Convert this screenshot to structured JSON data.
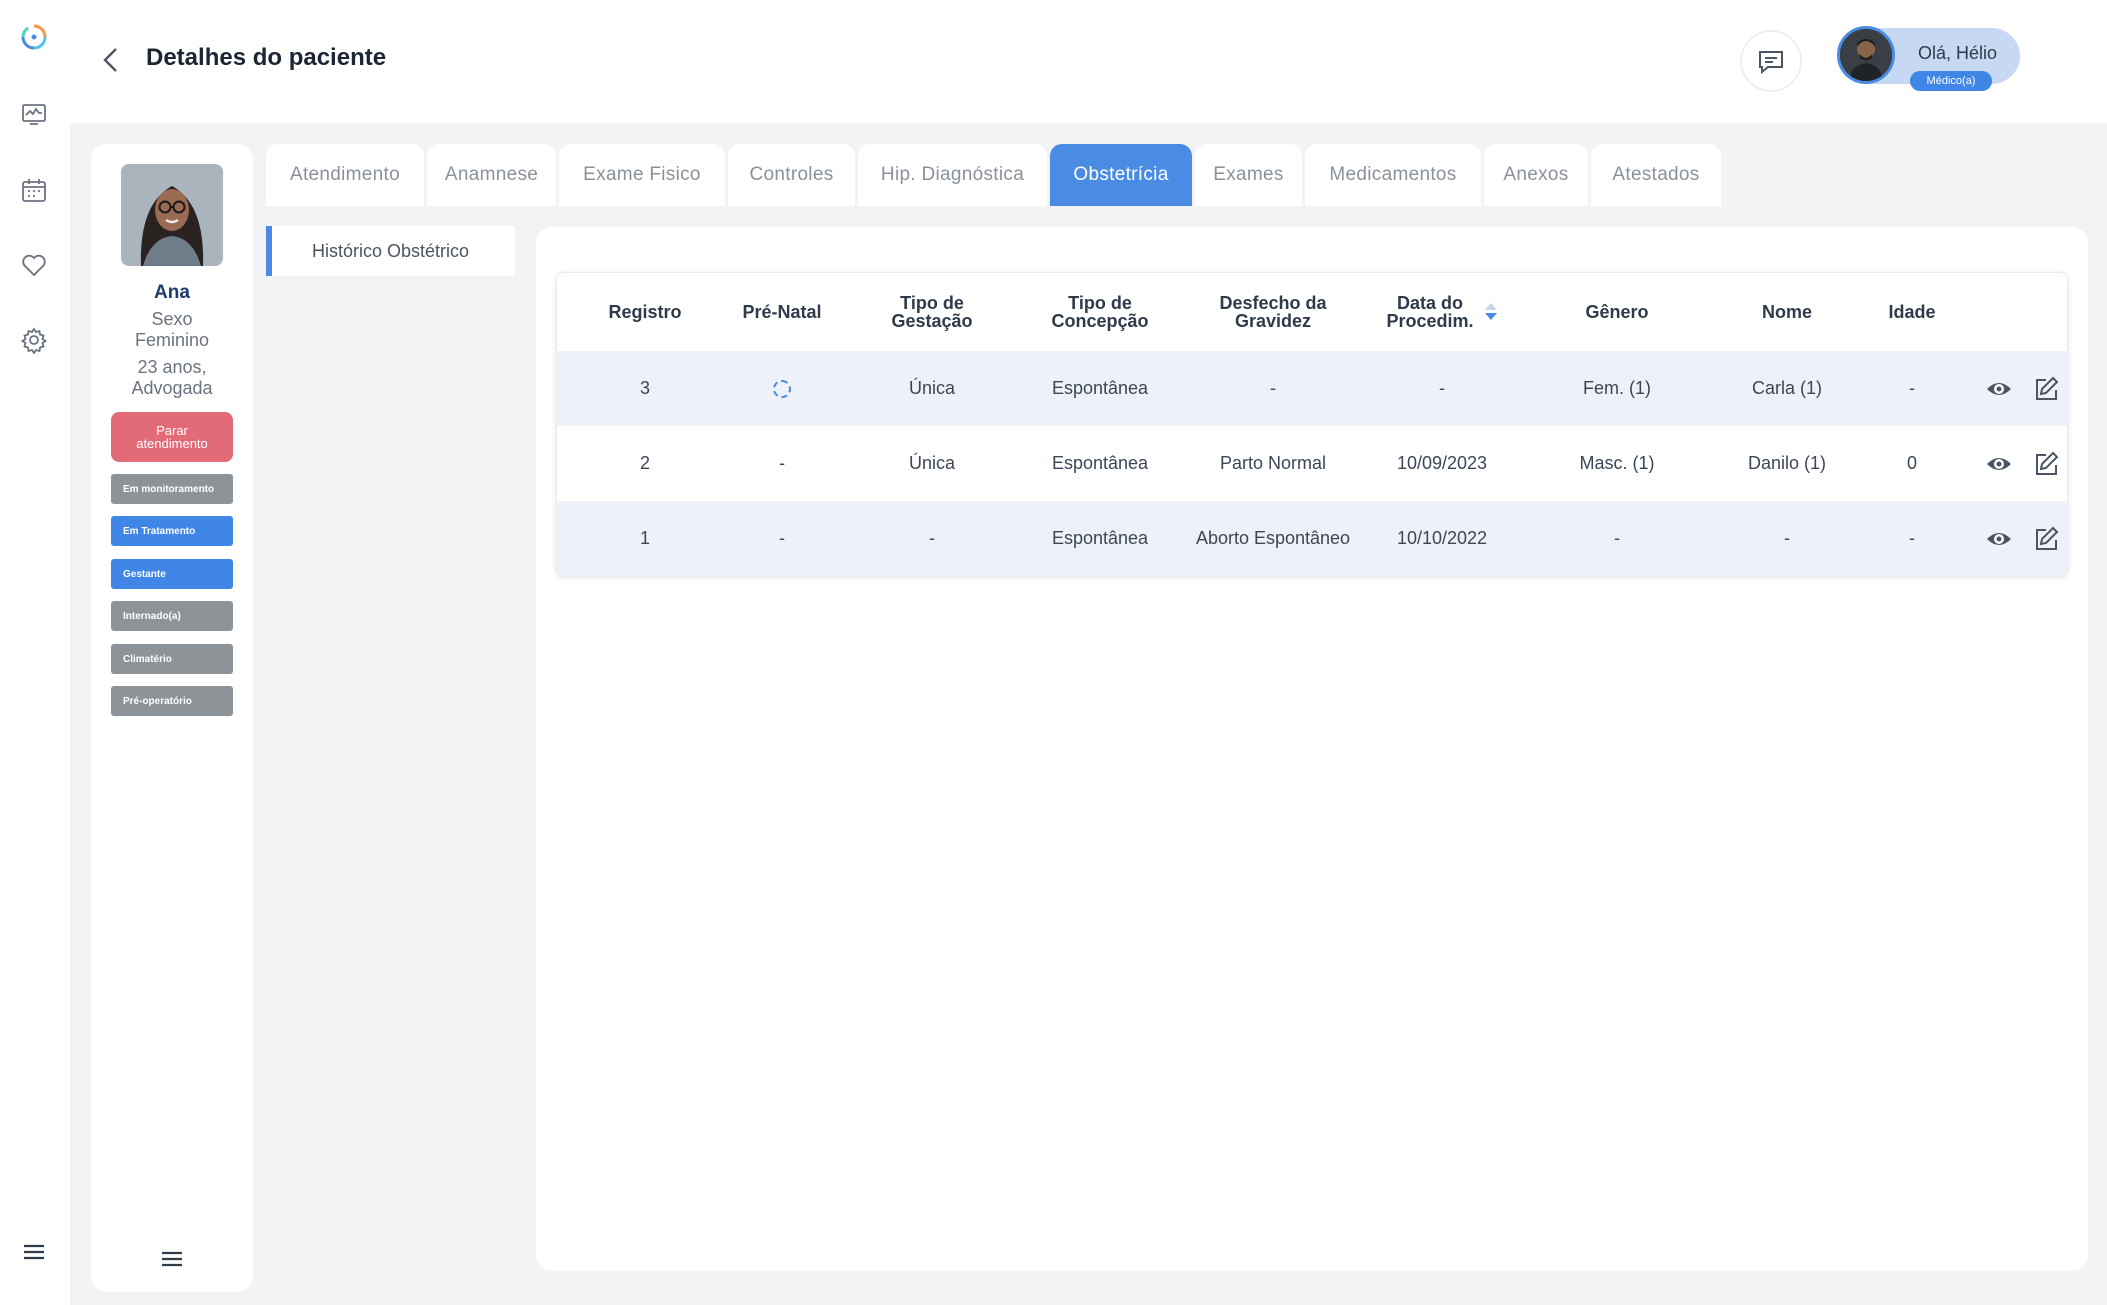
{
  "sidebar": {
    "icons": [
      "app-logo-icon",
      "monitor-icon",
      "calendar-icon",
      "heart-icon",
      "settings-icon",
      "menu-icon"
    ]
  },
  "header": {
    "title": "Detalhes do paciente",
    "user_greeting": "Olá, Hélio",
    "user_role": "Médico(a)"
  },
  "patient": {
    "name": "Ana",
    "sex_line1": "Sexo",
    "sex_line2": "Feminino",
    "age_line": "23 anos,",
    "occupation": "Advogada",
    "stop_button_line1": "Parar",
    "stop_button_line2": "atendimento",
    "tags": [
      {
        "label": "Em monitoramento",
        "color": "#8e9398"
      },
      {
        "label": "Em Tratamento",
        "color": "#3f86e6"
      },
      {
        "label": "Gestante",
        "color": "#3f86e6"
      },
      {
        "label": "Internado(a)",
        "color": "#8e9398"
      },
      {
        "label": "Climatério",
        "color": "#8e9398"
      },
      {
        "label": "Pré-operatório",
        "color": "#8e9398"
      }
    ]
  },
  "tabs": [
    {
      "label": "Atendimento",
      "active": false
    },
    {
      "label": "Anamnese",
      "active": false
    },
    {
      "label": "Exame Fisico",
      "active": false
    },
    {
      "label": "Controles",
      "active": false
    },
    {
      "label": "Hip. Diagnóstica",
      "active": false
    },
    {
      "label": "Obstetrícia",
      "active": true
    },
    {
      "label": "Exames",
      "active": false
    },
    {
      "label": "Medicamentos",
      "active": false
    },
    {
      "label": "Anexos",
      "active": false
    },
    {
      "label": "Atestados",
      "active": false
    }
  ],
  "subnav": {
    "active_item": "Histórico Obstétrico"
  },
  "table": {
    "headers": {
      "registro": "Registro",
      "pre_natal": "Pré-Natal",
      "tipo_gestacao_1": "Tipo de",
      "tipo_gestacao_2": "Gestação",
      "tipo_concepcao_1": "Tipo de",
      "tipo_concepcao_2": "Concepção",
      "desfecho_1": "Desfecho da",
      "desfecho_2": "Gravidez",
      "data_1": "Data do",
      "data_2": "Procedim.",
      "genero": "Gênero",
      "nome": "Nome",
      "idade": "Idade"
    },
    "rows": [
      {
        "registro": "3",
        "pre_natal": "",
        "tipo_gestacao": "Única",
        "tipo_concepcao": "Espontânea",
        "desfecho": "-",
        "data": "-",
        "genero": "Fem. (1)",
        "nome": "Carla (1)",
        "idade": "-"
      },
      {
        "registro": "2",
        "pre_natal": "-",
        "tipo_gestacao": "Única",
        "tipo_concepcao": "Espontânea",
        "desfecho": "Parto Normal",
        "data": "10/09/2023",
        "genero": "Masc. (1)",
        "nome": "Danilo (1)",
        "idade": "0"
      },
      {
        "registro": "1",
        "pre_natal": "-",
        "tipo_gestacao": "-",
        "tipo_concepcao": "Espontânea",
        "desfecho": "Aborto Espontâneo",
        "data": "10/10/2022",
        "genero": "-",
        "nome": "-",
        "idade": "-"
      }
    ]
  }
}
